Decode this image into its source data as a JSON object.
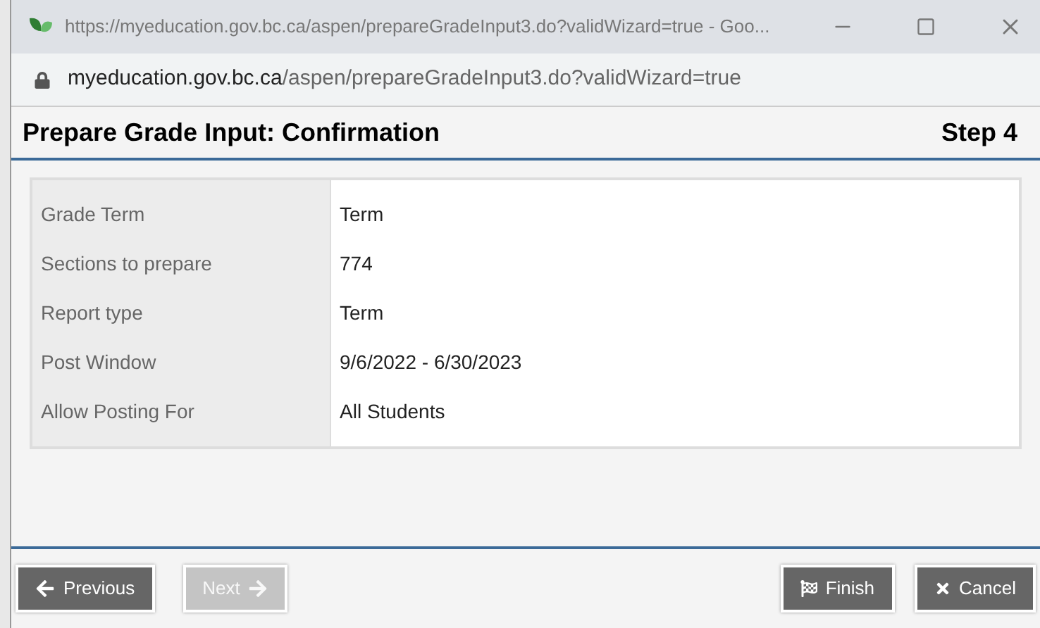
{
  "window": {
    "title": "https://myeducation.gov.bc.ca/aspen/prepareGradeInput3.do?validWizard=true - Goo..."
  },
  "address_bar": {
    "domain": "myeducation.gov.bc.ca",
    "path": "/aspen/prepareGradeInput3.do?validWizard=true"
  },
  "header": {
    "title": "Prepare Grade Input: Confirmation",
    "step": "Step 4"
  },
  "details": [
    {
      "label": "Grade Term",
      "value": "Term"
    },
    {
      "label": "Sections to prepare",
      "value": "774"
    },
    {
      "label": "Report type",
      "value": "Term"
    },
    {
      "label": "Post Window",
      "value": "9/6/2022 - 6/30/2023"
    },
    {
      "label": "Allow Posting For",
      "value": "All Students"
    }
  ],
  "buttons": [
    {
      "kind": "previous",
      "label": "Previous",
      "disabled": false
    },
    {
      "kind": "next",
      "label": "Next",
      "disabled": true
    },
    {
      "kind": "finish",
      "label": "Finish",
      "disabled": false
    },
    {
      "kind": "cancel",
      "label": "Cancel",
      "disabled": false
    }
  ]
}
